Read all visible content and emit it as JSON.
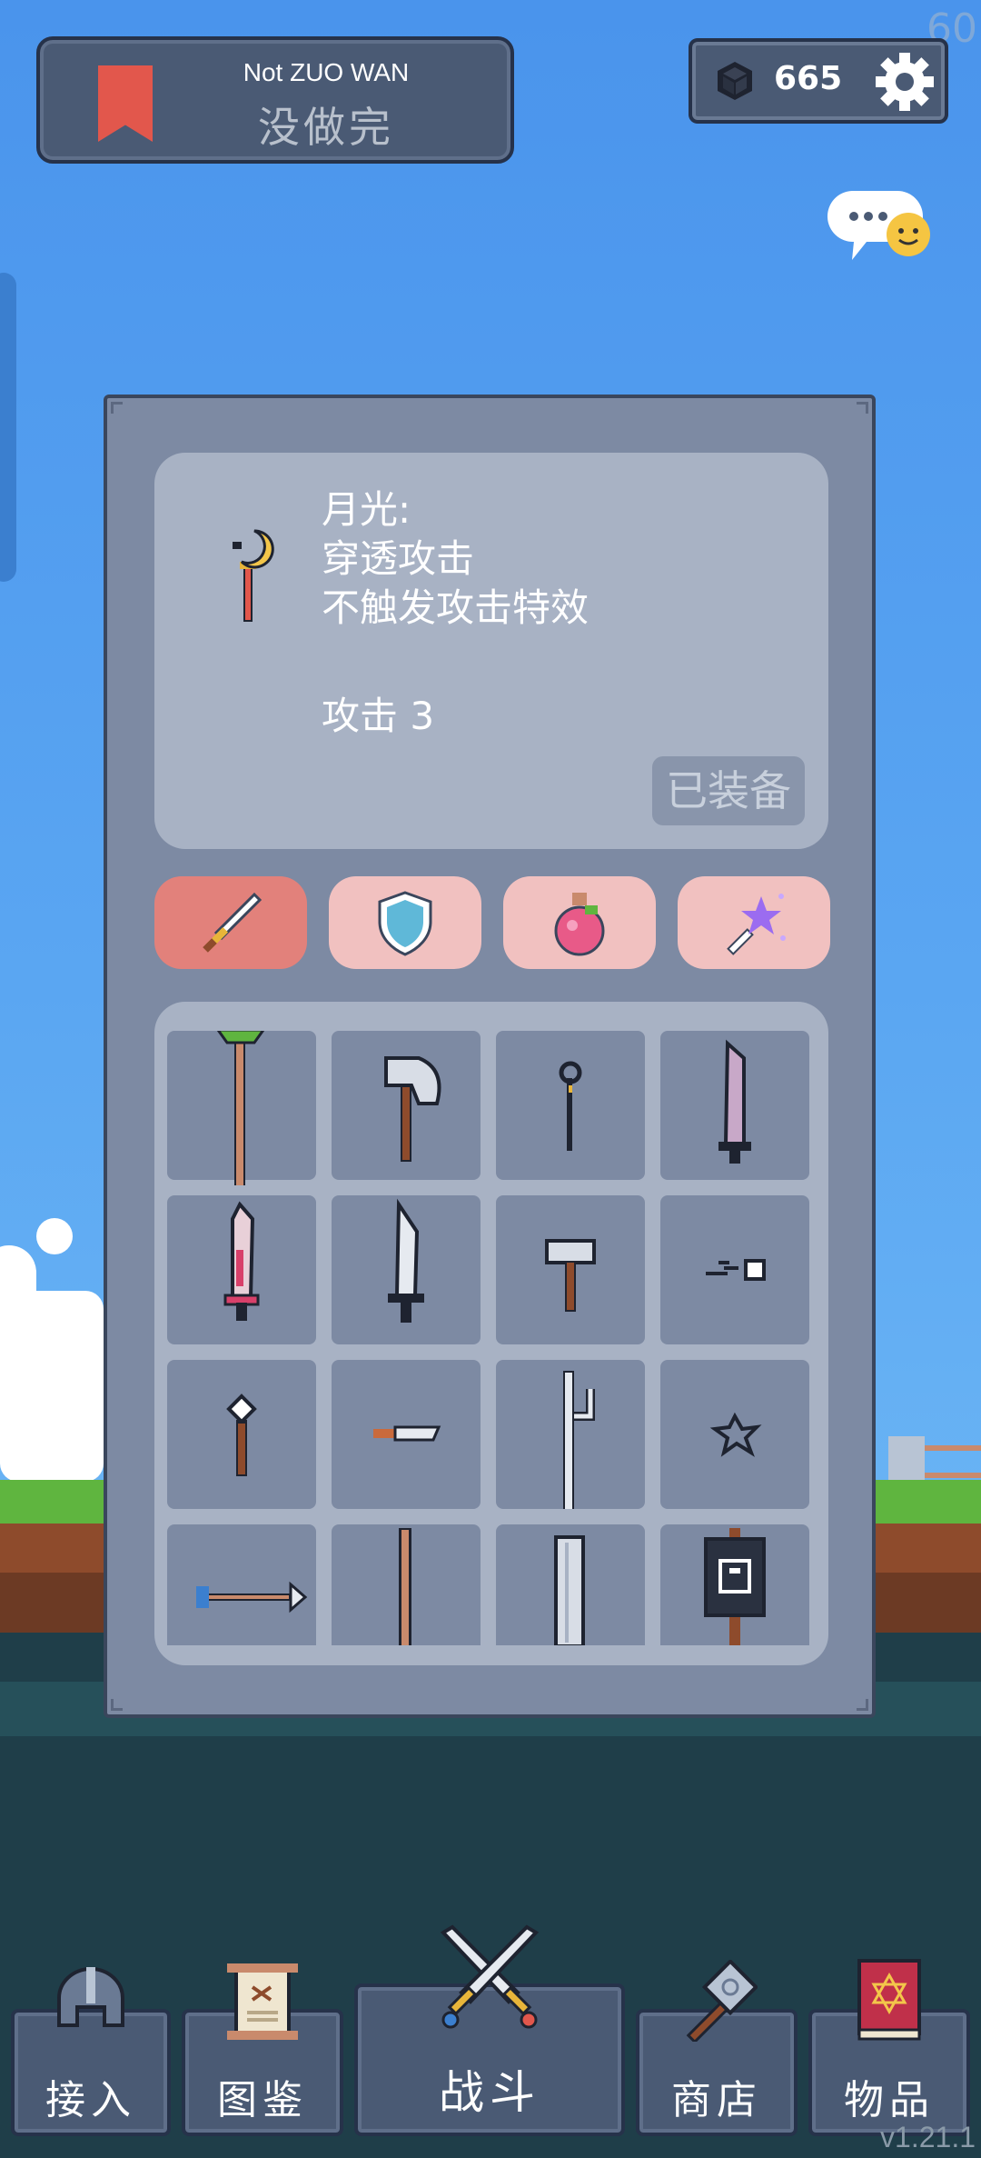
{
  "fps": "60",
  "level": {
    "title_en": "Not ZUO WAN",
    "title_cn": "没做完"
  },
  "currency": {
    "gems": "665"
  },
  "item": {
    "desc": "月光:\n穿透攻击\n不触发攻击特效",
    "attack": "攻击  3",
    "equipped_label": "已装备"
  },
  "tabs": [
    {
      "name": "weapon",
      "icon": "sword-icon",
      "active": true
    },
    {
      "name": "armor",
      "icon": "shield-icon",
      "active": false
    },
    {
      "name": "potion",
      "icon": "potion-icon",
      "active": false
    },
    {
      "name": "magic",
      "icon": "magic-wand-icon",
      "active": false
    }
  ],
  "inventory": [
    "leaf-staff-icon",
    "axe-icon",
    "small-wand-icon",
    "dark-sword-icon",
    "crimson-sword-icon",
    "steel-sword-icon",
    "hammer-icon",
    "thrown-stone-icon",
    "mace-icon",
    "knife-icon",
    "hook-staff-icon",
    "shuriken-icon",
    "arrow-icon",
    "wooden-pole-icon",
    "broadsword-icon",
    "banner-icon"
  ],
  "nav": [
    {
      "label": "接入",
      "icon": "helmet-icon"
    },
    {
      "label": "图鉴",
      "icon": "scroll-icon"
    },
    {
      "label": "战斗",
      "icon": "crossed-swords-icon"
    },
    {
      "label": "商店",
      "icon": "hammer-icon"
    },
    {
      "label": "物品",
      "icon": "spellbook-icon"
    }
  ],
  "version": "v1.21.1"
}
